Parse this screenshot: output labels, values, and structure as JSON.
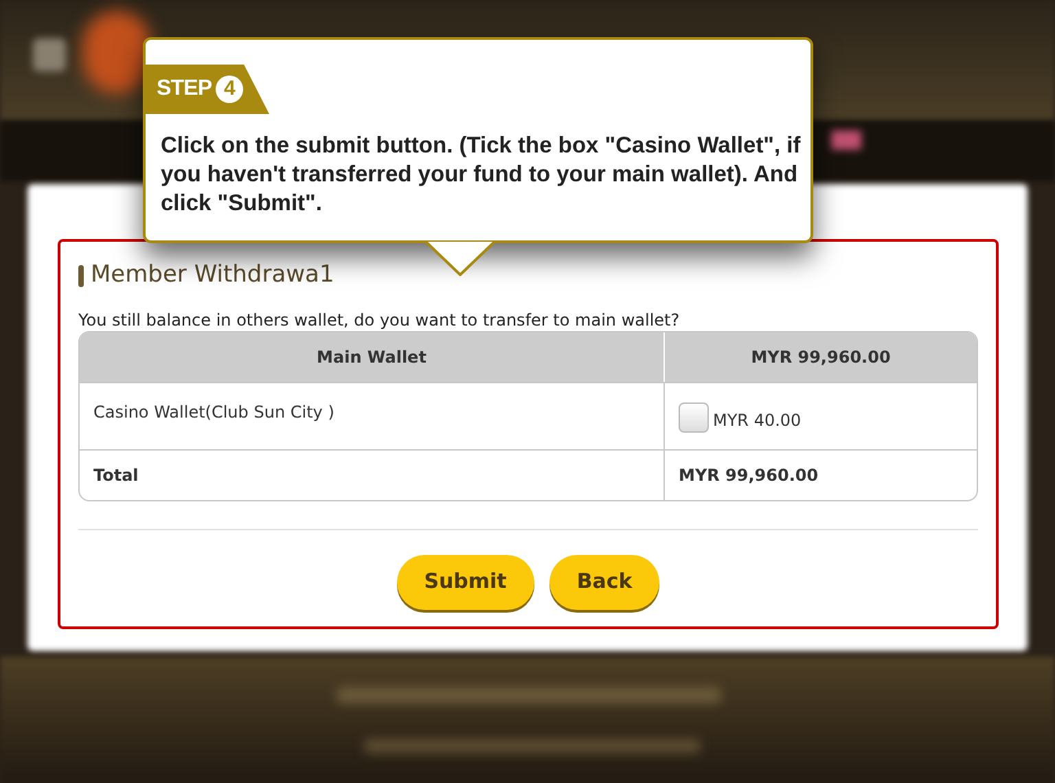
{
  "callout": {
    "step_label": "STEP",
    "step_number": "4",
    "text": "Click on the submit button. (Tick the box \"Casino Wallet\", if you haven't transferred your fund to your main wallet). And click \"Submit\"."
  },
  "panel": {
    "title": "Member Withdrawa1",
    "prompt": "You still balance in others wallet, do you want to transfer to main wallet?",
    "header": [
      "Main Wallet",
      "MYR 99,960.00"
    ],
    "rows": [
      {
        "label": "Casino Wallet(Club Sun City )",
        "checked": false,
        "amount": "MYR 40.00"
      }
    ],
    "total": [
      "Total",
      "MYR 99,960.00"
    ]
  },
  "buttons": [
    "Submit",
    "Back"
  ]
}
